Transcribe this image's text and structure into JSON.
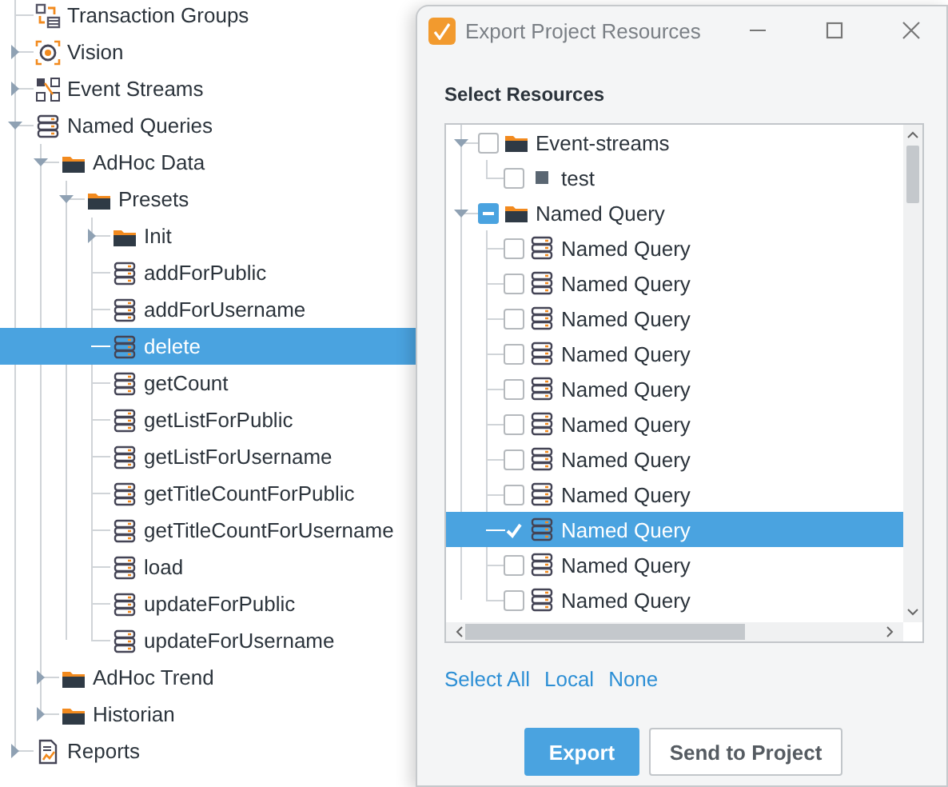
{
  "tree": {
    "items": [
      {
        "label": "Transaction Groups",
        "kind": "transaction",
        "selected": false
      },
      {
        "label": "Vision",
        "kind": "vision",
        "expanded": false,
        "selected": false
      },
      {
        "label": "Event Streams",
        "kind": "streams",
        "expanded": false,
        "selected": false
      },
      {
        "label": "Named Queries",
        "kind": "database",
        "expanded": true,
        "selected": false,
        "children": [
          {
            "label": "AdHoc Data",
            "kind": "folder",
            "expanded": true,
            "selected": false,
            "children": [
              {
                "label": "Presets",
                "kind": "folder",
                "expanded": true,
                "selected": false,
                "children": [
                  {
                    "label": "Init",
                    "kind": "folder",
                    "expanded": false,
                    "selected": false
                  },
                  {
                    "label": "addForPublic",
                    "kind": "database",
                    "selected": false
                  },
                  {
                    "label": "addForUsername",
                    "kind": "database",
                    "selected": false
                  },
                  {
                    "label": "delete",
                    "kind": "database",
                    "selected": true
                  },
                  {
                    "label": "getCount",
                    "kind": "database",
                    "selected": false
                  },
                  {
                    "label": "getListForPublic",
                    "kind": "database",
                    "selected": false
                  },
                  {
                    "label": "getListForUsername",
                    "kind": "database",
                    "selected": false
                  },
                  {
                    "label": "getTitleCountForPublic",
                    "kind": "database",
                    "selected": false
                  },
                  {
                    "label": "getTitleCountForUsername",
                    "kind": "database",
                    "selected": false
                  },
                  {
                    "label": "load",
                    "kind": "database",
                    "selected": false
                  },
                  {
                    "label": "updateForPublic",
                    "kind": "database",
                    "selected": false
                  },
                  {
                    "label": "updateForUsername",
                    "kind": "database",
                    "selected": false
                  }
                ]
              }
            ]
          },
          {
            "label": "AdHoc Trend",
            "kind": "folder",
            "expanded": false,
            "selected": false
          },
          {
            "label": "Historian",
            "kind": "folder",
            "expanded": false,
            "selected": false
          }
        ]
      },
      {
        "label": "Reports",
        "kind": "reports",
        "expanded": false,
        "selected": false
      }
    ]
  },
  "dialog": {
    "title": "Export Project Resources",
    "heading": "Select Resources",
    "resources": [
      {
        "label": "Event-streams",
        "kind": "folder",
        "expanded": true,
        "checked": false,
        "indeterminate": false,
        "selected": false,
        "children": [
          {
            "label": "test",
            "kind": "square",
            "checked": false,
            "indeterminate": false,
            "selected": false
          }
        ]
      },
      {
        "label": "Named Query",
        "kind": "folder",
        "expanded": true,
        "indeterminate": true,
        "selected": false,
        "children": [
          {
            "label": "Named Query",
            "kind": "database",
            "checked": false,
            "indeterminate": false,
            "selected": false
          },
          {
            "label": "Named Query",
            "kind": "database",
            "checked": false,
            "indeterminate": false,
            "selected": false
          },
          {
            "label": "Named Query",
            "kind": "database",
            "checked": false,
            "indeterminate": false,
            "selected": false
          },
          {
            "label": "Named Query",
            "kind": "database",
            "checked": false,
            "indeterminate": false,
            "selected": false
          },
          {
            "label": "Named Query",
            "kind": "database",
            "checked": false,
            "indeterminate": false,
            "selected": false
          },
          {
            "label": "Named Query",
            "kind": "database",
            "checked": false,
            "indeterminate": false,
            "selected": false
          },
          {
            "label": "Named Query",
            "kind": "database",
            "checked": false,
            "indeterminate": false,
            "selected": false
          },
          {
            "label": "Named Query",
            "kind": "database",
            "checked": false,
            "indeterminate": false,
            "selected": false
          },
          {
            "label": "Named Query",
            "kind": "database",
            "checked": true,
            "indeterminate": false,
            "selected": true
          },
          {
            "label": "Named Query",
            "kind": "database",
            "checked": false,
            "indeterminate": false,
            "selected": false
          },
          {
            "label": "Named Query",
            "kind": "database",
            "checked": false,
            "indeterminate": false,
            "selected": false
          }
        ]
      }
    ],
    "links": [
      "Select All",
      "Local",
      "None"
    ],
    "buttons": [
      {
        "label": "Export",
        "kind": "primary"
      },
      {
        "label": "Send to Project",
        "kind": "secondary"
      }
    ]
  }
}
